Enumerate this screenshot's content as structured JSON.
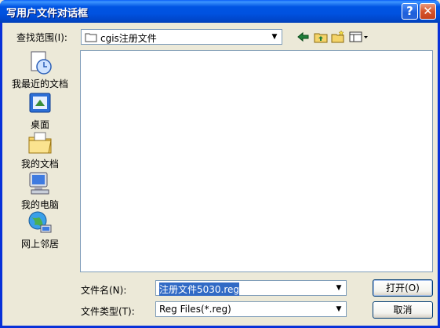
{
  "window": {
    "title": "写用户文件对话框"
  },
  "titlebar_buttons": {
    "help": "?",
    "close": "✕"
  },
  "look_in": {
    "label": "查找范围(I):",
    "value": "cgis注册文件"
  },
  "toolbar": {
    "icons": [
      "back-icon",
      "up-folder-icon",
      "new-folder-icon",
      "view-menu-icon"
    ]
  },
  "places": [
    {
      "label": "我最近的文档",
      "icon": "recent-documents-icon"
    },
    {
      "label": "桌面",
      "icon": "desktop-icon"
    },
    {
      "label": "我的文档",
      "icon": "my-documents-icon"
    },
    {
      "label": "我的电脑",
      "icon": "my-computer-icon"
    },
    {
      "label": "网上邻居",
      "icon": "network-places-icon"
    }
  ],
  "file_name": {
    "label": "文件名(N):",
    "value": "注册文件5030.reg"
  },
  "file_type": {
    "label": "文件类型(T):",
    "value": "Reg Files(*.reg)"
  },
  "buttons": {
    "open": "打开(O)",
    "cancel": "取消"
  },
  "colors": {
    "titlebar": "#0054e3",
    "dialog_bg": "#ece9d8",
    "selection": "#316ac5"
  }
}
